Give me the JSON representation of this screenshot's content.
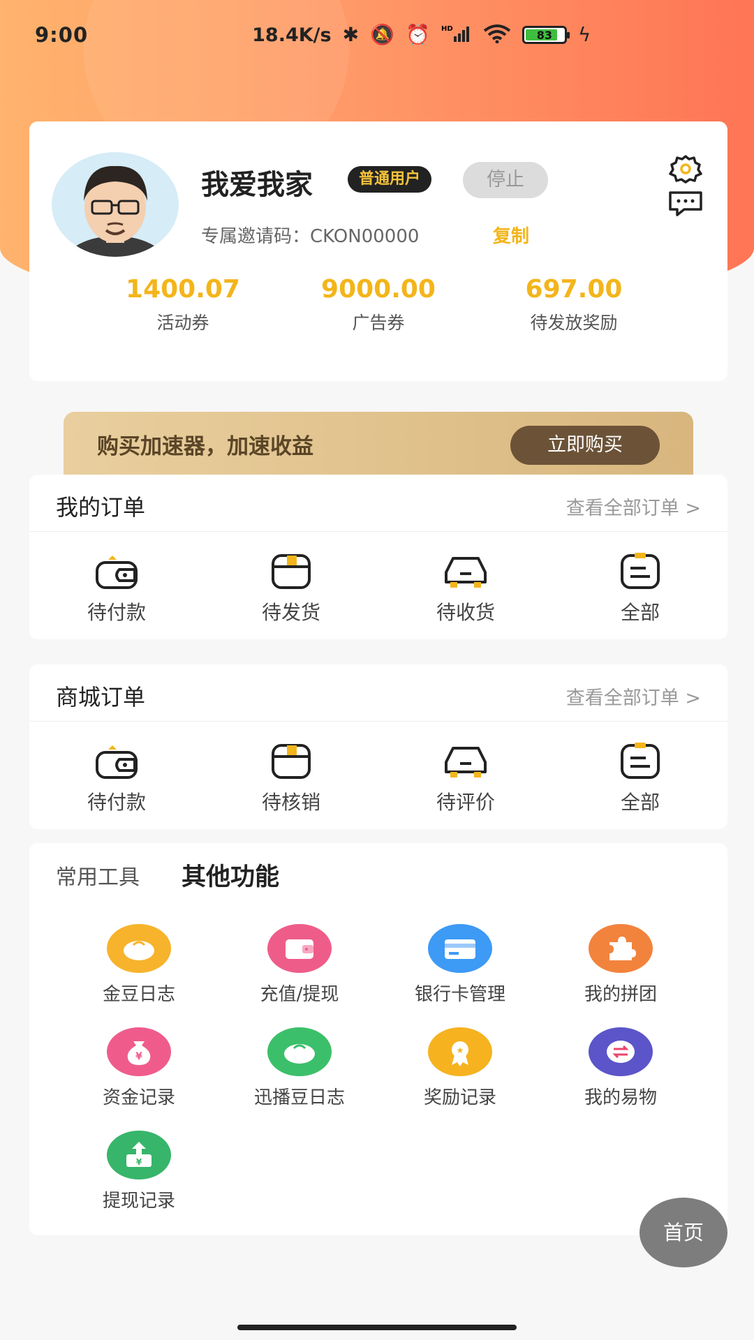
{
  "status_bar": {
    "time": "9:00",
    "net_speed": "18.4K/s",
    "battery": "83",
    "icons": [
      "bluetooth-icon",
      "mute-icon",
      "alarm-icon",
      "signal-icon",
      "wifi-icon",
      "battery-icon",
      "charging-icon"
    ]
  },
  "profile": {
    "username": "我爱我家",
    "user_badge": "普通用户",
    "stop_label": "停止",
    "invite_label": "专属邀请码：CKON00000",
    "copy_label": "复制",
    "stats": [
      {
        "value": "1400.07",
        "label": "活动券"
      },
      {
        "value": "9000.00",
        "label": "广告券"
      },
      {
        "value": "697.00",
        "label": "待发放奖励"
      }
    ]
  },
  "promo": {
    "text": "购买加速器，加速收益",
    "button": "立即购买"
  },
  "my_orders": {
    "title": "我的订单",
    "view_all": "查看全部订单 >",
    "items": [
      {
        "label": "待付款",
        "icon": "wallet-icon"
      },
      {
        "label": "待发货",
        "icon": "box-icon"
      },
      {
        "label": "待收货",
        "icon": "car-icon"
      },
      {
        "label": "全部",
        "icon": "list-icon"
      }
    ]
  },
  "mall_orders": {
    "title": "商城订单",
    "view_all": "查看全部订单 >",
    "items": [
      {
        "label": "待付款",
        "icon": "wallet-icon"
      },
      {
        "label": "待核销",
        "icon": "box-icon"
      },
      {
        "label": "待评价",
        "icon": "car-icon"
      },
      {
        "label": "全部",
        "icon": "list-icon"
      }
    ]
  },
  "tools": {
    "tab_common": "常用工具",
    "tab_other": "其他功能",
    "items": [
      {
        "label": "金豆日志",
        "icon": "gold-bean-icon",
        "color": "#f7b32b"
      },
      {
        "label": "充值/提现",
        "icon": "wallet-icon",
        "color": "#ee5d8a"
      },
      {
        "label": "银行卡管理",
        "icon": "bank-card-icon",
        "color": "#3d9af5"
      },
      {
        "label": "我的拼团",
        "icon": "puzzle-icon",
        "color": "#f2833d"
      },
      {
        "label": "资金记录",
        "icon": "money-bag-icon",
        "color": "#ef5c8c"
      },
      {
        "label": "迅播豆日志",
        "icon": "green-bean-icon",
        "color": "#3cbf6a"
      },
      {
        "label": "奖励记录",
        "icon": "award-icon",
        "color": "#f6b21f"
      },
      {
        "label": "我的易物",
        "icon": "exchange-icon",
        "color": "#5b55c9"
      },
      {
        "label": "提现记录",
        "icon": "withdraw-icon",
        "color": "#37b56a"
      }
    ]
  },
  "fab": {
    "label": "首页"
  }
}
